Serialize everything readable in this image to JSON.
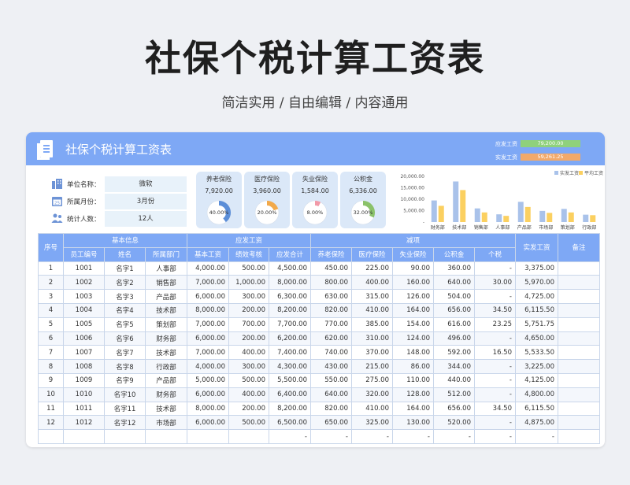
{
  "hero": {
    "title": "社保个税计算工资表",
    "subtitle": "简洁实用 / 自由编辑 / 内容通用"
  },
  "sheet": {
    "title": "社保个税计算工资表",
    "summary": [
      {
        "label": "应发工资",
        "value": "79,200.00",
        "color": "#8fd17c"
      },
      {
        "label": "实发工资",
        "value": "59,261.25",
        "color": "#f2a96a"
      }
    ],
    "info": [
      {
        "label": "单位名称：",
        "value": "微软",
        "icon": "building-icon"
      },
      {
        "label": "所属月份：",
        "value": "3月份",
        "icon": "calendar-icon"
      },
      {
        "label": "统计人数：",
        "value": "12人",
        "icon": "people-icon"
      }
    ],
    "insurance": [
      {
        "name": "养老保险",
        "amount": "7,920.00",
        "pct_label": "40.00%",
        "pct": 40,
        "color": "#5b8ed8"
      },
      {
        "name": "医疗保险",
        "amount": "3,960.00",
        "pct_label": "20.00%",
        "pct": 20,
        "color": "#f2a94a"
      },
      {
        "name": "失业保险",
        "amount": "1,584.00",
        "pct_label": "8.00%",
        "pct": 8,
        "color": "#f29aa8"
      },
      {
        "name": "公积金",
        "amount": "6,336.00",
        "pct_label": "32.00%",
        "pct": 32,
        "color": "#8bc26a"
      }
    ],
    "headers": {
      "seq": "序号",
      "basic": "基本信息",
      "gross_group": "应发工资",
      "deduct_group": "减项",
      "net": "实发工资",
      "note": "备注",
      "sub": [
        "员工编号",
        "姓名",
        "所属部门",
        "基本工资",
        "绩效考核",
        "应发合计",
        "养老保险",
        "医疗保险",
        "失业保险",
        "公积金",
        "个税"
      ]
    },
    "rows": [
      [
        "1",
        "1001",
        "名字1",
        "人事部",
        "4,000.00",
        "500.00",
        "4,500.00",
        "450.00",
        "225.00",
        "90.00",
        "360.00",
        "-",
        "3,375.00",
        ""
      ],
      [
        "2",
        "1002",
        "名字2",
        "销售部",
        "7,000.00",
        "1,000.00",
        "8,000.00",
        "800.00",
        "400.00",
        "160.00",
        "640.00",
        "30.00",
        "5,970.00",
        ""
      ],
      [
        "3",
        "1003",
        "名字3",
        "产品部",
        "6,000.00",
        "300.00",
        "6,300.00",
        "630.00",
        "315.00",
        "126.00",
        "504.00",
        "-",
        "4,725.00",
        ""
      ],
      [
        "4",
        "1004",
        "名字4",
        "技术部",
        "8,000.00",
        "200.00",
        "8,200.00",
        "820.00",
        "410.00",
        "164.00",
        "656.00",
        "34.50",
        "6,115.50",
        ""
      ],
      [
        "5",
        "1005",
        "名字5",
        "策划部",
        "7,000.00",
        "700.00",
        "7,700.00",
        "770.00",
        "385.00",
        "154.00",
        "616.00",
        "23.25",
        "5,751.75",
        ""
      ],
      [
        "6",
        "1006",
        "名字6",
        "财务部",
        "6,000.00",
        "200.00",
        "6,200.00",
        "620.00",
        "310.00",
        "124.00",
        "496.00",
        "-",
        "4,650.00",
        ""
      ],
      [
        "7",
        "1007",
        "名字7",
        "技术部",
        "7,000.00",
        "400.00",
        "7,400.00",
        "740.00",
        "370.00",
        "148.00",
        "592.00",
        "16.50",
        "5,533.50",
        ""
      ],
      [
        "8",
        "1008",
        "名字8",
        "行政部",
        "4,000.00",
        "300.00",
        "4,300.00",
        "430.00",
        "215.00",
        "86.00",
        "344.00",
        "-",
        "3,225.00",
        ""
      ],
      [
        "9",
        "1009",
        "名字9",
        "产品部",
        "5,000.00",
        "500.00",
        "5,500.00",
        "550.00",
        "275.00",
        "110.00",
        "440.00",
        "-",
        "4,125.00",
        ""
      ],
      [
        "10",
        "1010",
        "名字10",
        "财务部",
        "6,000.00",
        "400.00",
        "6,400.00",
        "640.00",
        "320.00",
        "128.00",
        "512.00",
        "-",
        "4,800.00",
        ""
      ],
      [
        "11",
        "1011",
        "名字11",
        "技术部",
        "8,000.00",
        "200.00",
        "8,200.00",
        "820.00",
        "410.00",
        "164.00",
        "656.00",
        "34.50",
        "6,115.50",
        ""
      ],
      [
        "12",
        "1012",
        "名字12",
        "市场部",
        "6,000.00",
        "500.00",
        "6,500.00",
        "650.00",
        "325.00",
        "130.00",
        "520.00",
        "-",
        "4,875.00",
        ""
      ],
      [
        "",
        "",
        "",
        "",
        "",
        "",
        "-",
        "-",
        "-",
        "-",
        "-",
        "-",
        "-",
        ""
      ]
    ]
  },
  "chart_data": {
    "type": "bar",
    "categories": [
      "财务部",
      "技术部",
      "销售部",
      "人事部",
      "产品部",
      "市场部",
      "策划部",
      "行政部"
    ],
    "series": [
      {
        "name": "实发工资",
        "values": [
          9450,
          17764.5,
          5970,
          3375,
          8850,
          4875,
          5751.75,
          3225
        ],
        "color": "#a9c2ea"
      },
      {
        "name": "平均工资",
        "values": [
          7100,
          14000,
          4200,
          2700,
          6600,
          4000,
          4200,
          3000
        ],
        "color": "#fbd060"
      }
    ],
    "yticks": [
      "20,000.00",
      "15,000.00",
      "10,000.00",
      "5,000.00",
      "-"
    ],
    "ylim": [
      0,
      20000
    ],
    "legend": "top-right"
  }
}
